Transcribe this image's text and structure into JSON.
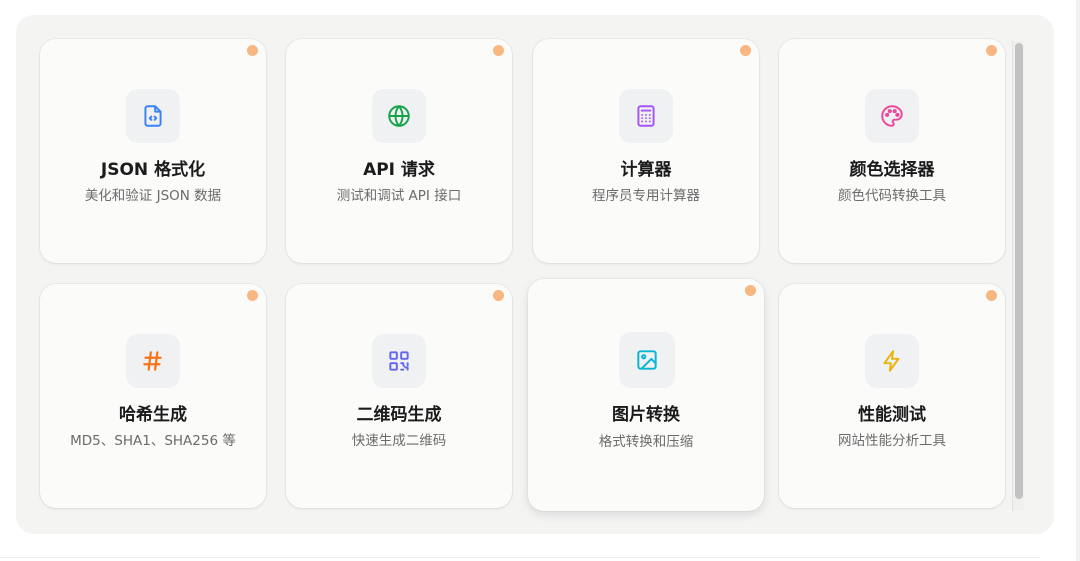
{
  "tools": [
    {
      "title": "JSON 格式化",
      "subtitle": "美化和验证 JSON 数据",
      "icon": "file-code-icon",
      "color": "#3b82f6"
    },
    {
      "title": "API 请求",
      "subtitle": "测试和调试 API 接口",
      "icon": "globe-icon",
      "color": "#16a34a"
    },
    {
      "title": "计算器",
      "subtitle": "程序员专用计算器",
      "icon": "calculator-icon",
      "color": "#a855f7"
    },
    {
      "title": "颜色选择器",
      "subtitle": "颜色代码转换工具",
      "icon": "palette-icon",
      "color": "#ec4899"
    },
    {
      "title": "哈希生成",
      "subtitle": "MD5、SHA1、SHA256 等",
      "icon": "hash-icon",
      "color": "#f97316"
    },
    {
      "title": "二维码生成",
      "subtitle": "快速生成二维码",
      "icon": "qr-code-icon",
      "color": "#6366f1"
    },
    {
      "title": "图片转换",
      "subtitle": "格式转换和压缩",
      "icon": "image-icon",
      "color": "#06b6d4"
    },
    {
      "title": "性能测试",
      "subtitle": "网站性能分析工具",
      "icon": "lightning-icon",
      "color": "#eab308"
    }
  ],
  "colors": {
    "status_dot": "#f8b681",
    "panel_bg": "#f4f4f3",
    "card_bg": "#fbfbfa"
  }
}
